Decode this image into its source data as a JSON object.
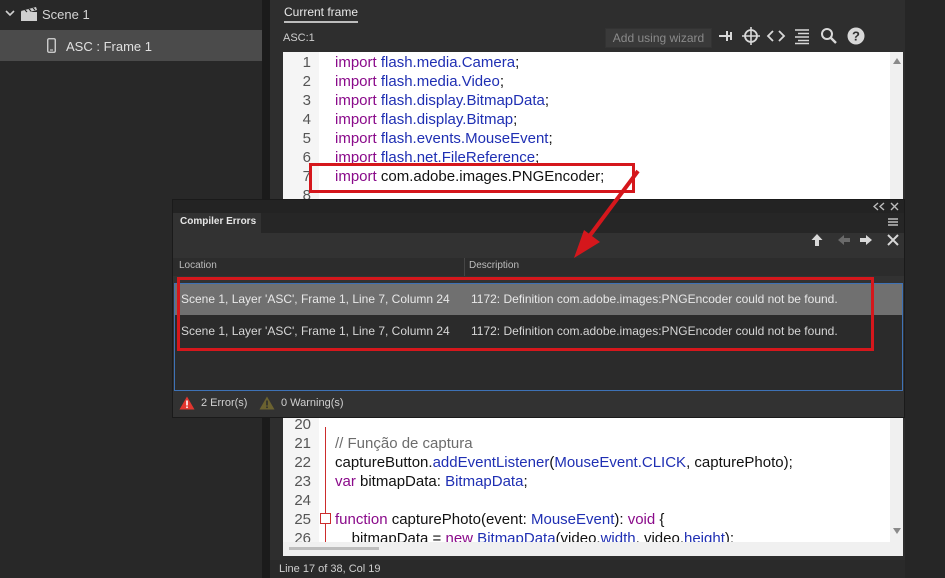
{
  "scene_tree": {
    "scene_label": "Scene 1",
    "frame_label": "ASC : Frame 1"
  },
  "actions": {
    "tab_label": "Current frame",
    "location": "ASC:1",
    "wizard_label": "Add using wizard",
    "toolbar_icons": [
      "pin-icon",
      "target-icon",
      "code-snippets-icon",
      "format-code-icon",
      "search-icon",
      "help-icon"
    ]
  },
  "code_top": [
    {
      "ln": "1",
      "kw": "import",
      "pkg": " flash.media.Camera",
      "end": ";"
    },
    {
      "ln": "2",
      "kw": "import",
      "pkg": " flash.media.Video",
      "end": ";"
    },
    {
      "ln": "3",
      "kw": "import",
      "pkg": " flash.display.BitmapData",
      "end": ";"
    },
    {
      "ln": "4",
      "kw": "import",
      "pkg": " flash.display.Bitmap",
      "end": ";"
    },
    {
      "ln": "5",
      "kw": "import",
      "pkg": " flash.events.MouseEvent",
      "end": ";"
    },
    {
      "ln": "6",
      "kw": "import",
      "pkg": " flash.net.FileReference",
      "end": ";"
    },
    {
      "ln": "7",
      "kw": "import",
      "pkg": " com.adobe.images.PNGEncoder;",
      "end": ""
    },
    {
      "ln": "8"
    }
  ],
  "code_bottom": {
    "l20": "20",
    "l21": "21",
    "comment": "// Função de captura",
    "l22": "22",
    "l22_a": "captureButton.",
    "l22_b": "addEventListener",
    "l22_c": "(",
    "l22_d": "MouseEvent.CLICK",
    "l22_e": ", capturePhoto);",
    "l23": "23",
    "l23_kw": "var",
    "l23_a": " bitmapData: ",
    "l23_cls": "BitmapData",
    "l23_end": ";",
    "l24": "24",
    "l25": "25",
    "l25_kw": "function",
    "l25_a": " capturePhoto(event: ",
    "l25_cls": "MouseEvent",
    "l25_b": "): ",
    "l25_void": "void",
    "l25_end": " {",
    "l26": "26",
    "l26_a": "    bitmapData = ",
    "l26_kw": "new",
    "l26_cls": " BitmapData",
    "l26_b": "(video.",
    "l26_c": "width",
    "l26_d": ", video.",
    "l26_e": "height",
    "l26_f": ");"
  },
  "compiler_errors": {
    "tab_label": "Compiler Errors",
    "columns": {
      "location": "Location",
      "description": "Description"
    },
    "rows": [
      {
        "location": "Scene 1, Layer 'ASC', Frame 1, Line 7, Column 24",
        "description": "1172: Definition com.adobe.images:PNGEncoder could not be found."
      },
      {
        "location": "Scene 1, Layer 'ASC', Frame 1, Line 7, Column 24",
        "description": "1172: Definition com.adobe.images:PNGEncoder could not be found."
      }
    ],
    "error_count": "2 Error(s)",
    "warning_count": "0 Warning(s)"
  },
  "status": "Line 17 of 38, Col 19",
  "colors": {
    "annotation_red": "#d5171c",
    "keyword": "#8a0a8a",
    "class": "#1f2fb3",
    "selection": "#3e72b6"
  }
}
